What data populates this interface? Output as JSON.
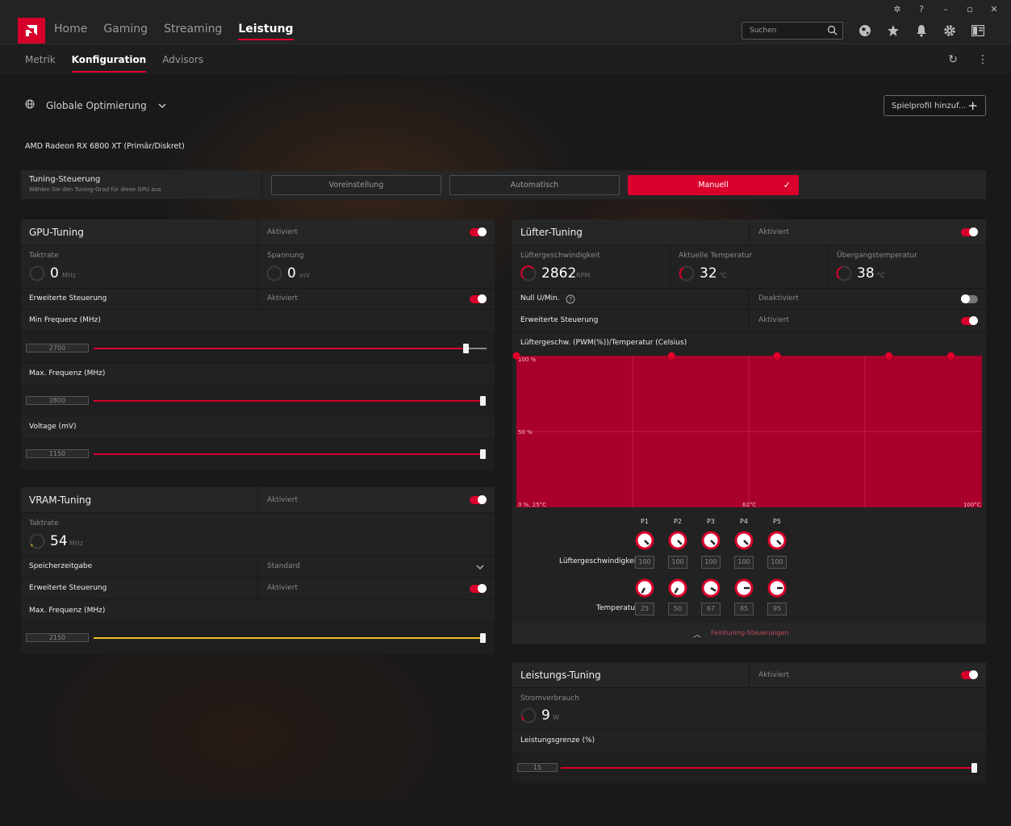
{
  "window_controls": [
    "bug-icon",
    "help-icon",
    "minimize-icon",
    "maximize-icon",
    "close-icon"
  ],
  "nav": {
    "items": [
      "Home",
      "Gaming",
      "Streaming",
      "Leistung"
    ],
    "active": "Leistung"
  },
  "search": {
    "placeholder": "Suchen"
  },
  "subnav": {
    "items": [
      "Metrik",
      "Konfiguration",
      "Advisors"
    ],
    "active": "Konfiguration"
  },
  "profile": {
    "label": "Globale Optimierung",
    "add_profile": "Spielprofil hinzuf..."
  },
  "gpu_name": "AMD Radeon RX 6800 XT (Primär/Diskret)",
  "tuning_control": {
    "title": "Tuning-Steuerung",
    "subtitle": "Wählen Sie den Tuning-Grad für diese GPU aus",
    "options": [
      "Voreinstellung",
      "Automatisch",
      "Manuell"
    ],
    "selected": "Manuell"
  },
  "gpu_tuning": {
    "title": "GPU-Tuning",
    "status": "Aktiviert",
    "enabled": true,
    "clock": {
      "label": "Taktrate",
      "value": "0",
      "unit": "MHz"
    },
    "voltage": {
      "label": "Spannung",
      "value": "0",
      "unit": "mV"
    },
    "advanced": {
      "label": "Erweiterte Steuerung",
      "status": "Aktiviert",
      "enabled": true
    },
    "min_freq": {
      "label": "Min Frequenz (MHz)",
      "value": "2700",
      "fraction": 0.965
    },
    "max_freq": {
      "label": "Max. Frequenz (MHz)",
      "value": "2800",
      "fraction": 1.0
    },
    "voltage_slider": {
      "label": "Voltage (mV)",
      "value": "1150",
      "fraction": 1.0
    }
  },
  "vram_tuning": {
    "title": "VRAM-Tuning",
    "status": "Aktiviert",
    "enabled": true,
    "clock": {
      "label": "Taktrate",
      "value": "54",
      "unit": "MHz"
    },
    "memory_timing": {
      "label": "Speicherzeitgabe",
      "value": "Standard"
    },
    "advanced": {
      "label": "Erweiterte Steuerung",
      "status": "Aktiviert",
      "enabled": true
    },
    "max_freq": {
      "label": "Max. Frequenz (MHz)",
      "value": "2150",
      "fraction": 1.0
    }
  },
  "fan_tuning": {
    "title": "Lüfter-Tuning",
    "status": "Aktiviert",
    "enabled": true,
    "fan_speed": {
      "label": "Lüftergeschwindigkeit",
      "value": "2862",
      "unit": "RPM"
    },
    "current_temp": {
      "label": "Aktuelle Temperatur",
      "value": "32",
      "unit": "°C"
    },
    "junction_temp": {
      "label": "Übergangstemperatur",
      "value": "38",
      "unit": "°C"
    },
    "zero_rpm": {
      "label": "Null U/Min.",
      "status": "Deaktiviert",
      "enabled": false
    },
    "advanced": {
      "label": "Erweiterte Steuerung",
      "status": "Aktiviert",
      "enabled": true
    },
    "curve_title": "Lüftergeschw. (PWM(%))/Temperatur (Celsius)",
    "chart_labels": {
      "y_top": "100 %",
      "y_mid": "50 %",
      "origin": "0 %, 25°C",
      "x_mid": "62°C",
      "x_max": "100°C"
    },
    "points": [
      "P1",
      "P2",
      "P3",
      "P4",
      "P5"
    ],
    "speed_row_label": "Lüftergeschwindigkeit",
    "temp_row_label": "Temperatur",
    "speeds": [
      "100",
      "100",
      "100",
      "100",
      "100"
    ],
    "temps": [
      "25",
      "50",
      "67",
      "85",
      "95"
    ],
    "fine_tuning": "Feintuning-Steuerungen"
  },
  "chart_data": {
    "type": "line",
    "x": [
      25,
      50,
      67,
      85,
      95
    ],
    "y": [
      100,
      100,
      100,
      100,
      100
    ],
    "xlim": [
      25,
      100
    ],
    "ylim": [
      0,
      100
    ],
    "xlabel": "",
    "ylabel": "",
    "title": "Lüftergeschw. (PWM(%))/Temperatur (Celsius)"
  },
  "power_tuning": {
    "title": "Leistungs-Tuning",
    "status": "Aktiviert",
    "enabled": true,
    "power": {
      "label": "Stromverbrauch",
      "value": "9",
      "unit": "W"
    },
    "limit": {
      "label": "Leistungsgrenze (%)",
      "value": "15",
      "fraction": 1.0
    }
  },
  "colors": {
    "accent": "#d9002b",
    "vram_slider": "#f0c020",
    "chart_fill": "#a8002a"
  }
}
